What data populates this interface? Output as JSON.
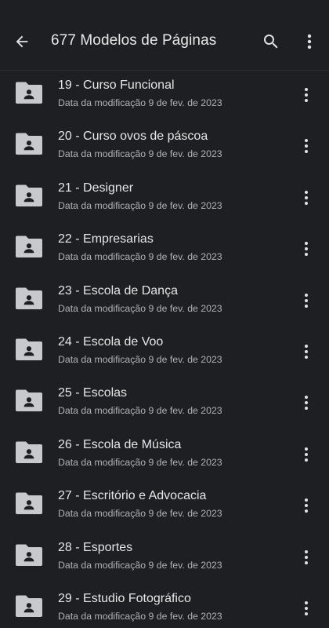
{
  "header": {
    "title": "677 Modelos de Páginas",
    "back_icon": "arrow-back-icon",
    "search_icon": "search-icon",
    "more_icon": "more-vert-icon"
  },
  "colors": {
    "background": "#1e1f22",
    "text_primary": "#e6e6e6",
    "text_secondary": "#b0b2b6",
    "icon": "#c8c9cc"
  },
  "items": [
    {
      "name": "19 - Curso Funcional",
      "meta": "Data da modificação 9 de fev. de 2023",
      "icon": "shared-folder-icon"
    },
    {
      "name": "20 - Curso ovos de páscoa",
      "meta": "Data da modificação 9 de fev. de 2023",
      "icon": "shared-folder-icon"
    },
    {
      "name": "21 - Designer",
      "meta": "Data da modificação 9 de fev. de 2023",
      "icon": "shared-folder-icon"
    },
    {
      "name": "22 - Empresarias",
      "meta": "Data da modificação 9 de fev. de 2023",
      "icon": "shared-folder-icon"
    },
    {
      "name": "23 - Escola de Dança",
      "meta": "Data da modificação 9 de fev. de 2023",
      "icon": "shared-folder-icon"
    },
    {
      "name": "24 - Escola de Voo",
      "meta": "Data da modificação 9 de fev. de 2023",
      "icon": "shared-folder-icon"
    },
    {
      "name": "25 - Escolas",
      "meta": "Data da modificação 9 de fev. de 2023",
      "icon": "shared-folder-icon"
    },
    {
      "name": "26 - Escola de Música",
      "meta": "Data da modificação 9 de fev. de 2023",
      "icon": "shared-folder-icon"
    },
    {
      "name": "27 - Escritório e Advocacia",
      "meta": "Data da modificação 9 de fev. de 2023",
      "icon": "shared-folder-icon"
    },
    {
      "name": "28 - Esportes",
      "meta": "Data da modificação 9 de fev. de 2023",
      "icon": "shared-folder-icon"
    },
    {
      "name": "29 - Estudio Fotográfico",
      "meta": "Data da modificação 9 de fev. de 2023",
      "icon": "shared-folder-icon"
    }
  ]
}
